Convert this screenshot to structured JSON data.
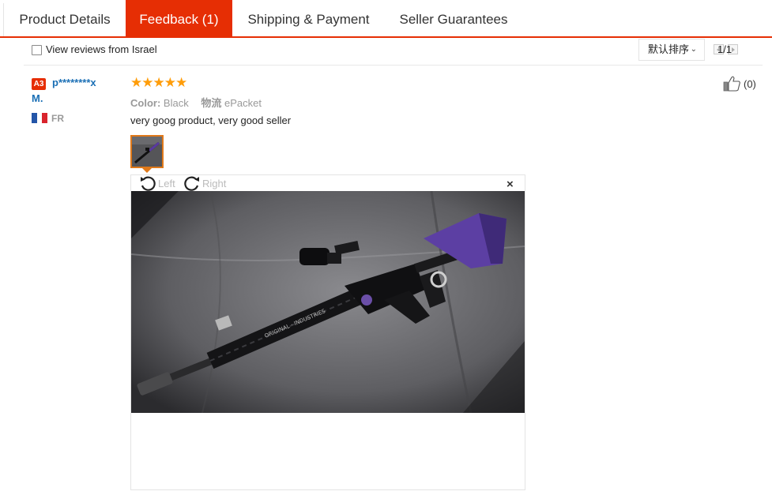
{
  "tabs": [
    {
      "label": "Product Details",
      "active": false
    },
    {
      "label": "Feedback (1)",
      "active": true
    },
    {
      "label": "Shipping & Payment",
      "active": false
    },
    {
      "label": "Seller Guarantees",
      "active": false
    }
  ],
  "filter": {
    "checkbox_label": "View reviews from Israel",
    "checked": false,
    "sort_label": "默认排序",
    "sort_caret": "⌄",
    "page_count": "1/1"
  },
  "review": {
    "level_badge": "A3",
    "username_line1": "p********x",
    "username_line2": "M.",
    "country_code": "FR",
    "flag_colors": [
      "#2456a8",
      "#ffffff",
      "#d9242d"
    ],
    "stars": "★★★★★",
    "star_count": 5,
    "color_key": "Color:",
    "color_value": "Black",
    "shipping_key": "物流",
    "shipping_value": "ePacket",
    "text": "very goog product, very good seller",
    "likes": "(0)"
  },
  "viewer": {
    "rotate_left": "Left",
    "rotate_right": "Right",
    "close": "×"
  },
  "colors": {
    "accent": "#e62e04",
    "username": "#1a6fb5",
    "stars": "#ff9d0a",
    "thumb_border": "#e0791a"
  }
}
